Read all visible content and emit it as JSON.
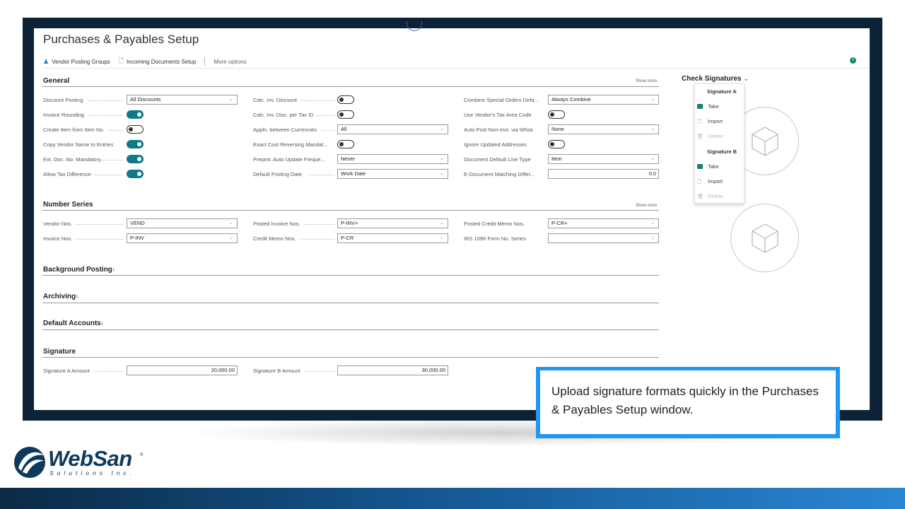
{
  "page_title": "Purchases & Payables Setup",
  "actions": {
    "vendor_posting_groups": "Vendor Posting Groups",
    "incoming_documents_setup": "Incoming Documents Setup",
    "more_options": "More options"
  },
  "general": {
    "heading": "General",
    "show_more": "Show more",
    "col1": {
      "discount_posting": {
        "label": "Discount Posting",
        "value": "All Discounts"
      },
      "invoice_rounding": {
        "label": "Invoice Rounding",
        "on": true
      },
      "create_item": {
        "label": "Create Item from Item No.",
        "on": false
      },
      "copy_vendor": {
        "label": "Copy Vendor Name to Entries",
        "on": true
      },
      "ext_doc": {
        "label": "Ext. Doc. No. Mandatory",
        "on": true
      },
      "allow_tax": {
        "label": "Allow Tax Difference",
        "on": true
      }
    },
    "col2": {
      "calc_inv_disc": {
        "label": "Calc. Inv. Discount",
        "on": false
      },
      "calc_inv_disc_tax": {
        "label": "Calc. Inv. Disc. per Tax ID",
        "on": false
      },
      "appln_currencies": {
        "label": "Appln. between Currencies",
        "value": "All"
      },
      "exact_cost": {
        "label": "Exact Cost Reversing Mandat...",
        "on": false
      },
      "prepmt": {
        "label": "Prepmt. Auto Update Freque...",
        "value": "Never"
      },
      "default_posting_date": {
        "label": "Default Posting Date",
        "value": "Work Date"
      }
    },
    "col3": {
      "combine_special": {
        "label": "Combine Special Orders Defa...",
        "value": "Always Combine"
      },
      "use_vendor_tax": {
        "label": "Use Vendor's Tax Area Code",
        "on": false
      },
      "auto_post": {
        "label": "Auto Post Non-Invt. via Whse.",
        "value": "None"
      },
      "ignore_updated": {
        "label": "Ignore Updated Addresses",
        "on": false
      },
      "doc_default_line": {
        "label": "Document Default Line Type",
        "value": "Item"
      },
      "e_document": {
        "label": "E-Document Matching Differ...",
        "value": "0.0"
      }
    }
  },
  "number_series": {
    "heading": "Number Series",
    "show_more": "Show more",
    "vendor_nos": {
      "label": "Vendor Nos.",
      "value": "VEND"
    },
    "invoice_nos": {
      "label": "Invoice Nos.",
      "value": "P-INV"
    },
    "posted_invoice_nos": {
      "label": "Posted Invoice Nos.",
      "value": "P-INV+"
    },
    "credit_memo_nos": {
      "label": "Credit Memo Nos.",
      "value": "P-CR"
    },
    "posted_credit_memo_nos": {
      "label": "Posted Credit Memo Nos.",
      "value": "P-CR+"
    },
    "irs_1096": {
      "label": "IRS 1096 Form No. Series",
      "value": ""
    }
  },
  "background_posting": "Background Posting",
  "archiving": "Archiving",
  "default_accounts": "Default Accounts",
  "signature": {
    "heading": "Signature",
    "a_amount": {
      "label": "Signature A Amount",
      "value": "20,000.00"
    },
    "b_amount": {
      "label": "Signature B Amount",
      "value": "30,000.00"
    }
  },
  "check_signatures": {
    "title": "Check Signatures",
    "sig_a": "Signature A",
    "sig_b": "Signature B",
    "take": "Take",
    "import": "Import",
    "delete": "Delete"
  },
  "callout": "Upload signature formats quickly in the Purchases & Payables Setup window.",
  "logo": {
    "name": "WebSan",
    "sub": "Solutions Inc.",
    "reg": "®"
  },
  "colors": {
    "frame": "#0c2236",
    "toggle_on": "#0e7a87",
    "callout_border": "#2196f3",
    "brand": "#0c3a5e"
  }
}
